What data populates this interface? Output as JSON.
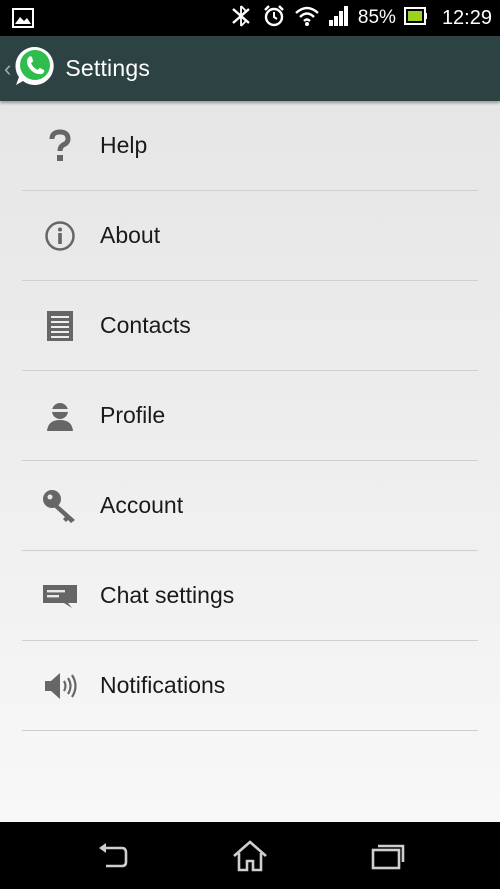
{
  "status_bar": {
    "battery_percent": "85%",
    "time": "12:29",
    "icons": [
      "gallery-icon",
      "bluetooth-icon",
      "alarm-icon",
      "wifi-icon",
      "signal-icon",
      "battery-icon"
    ]
  },
  "action_bar": {
    "title": "Settings",
    "logo": "whatsapp-logo",
    "colors": {
      "background": "#2d4343",
      "logo_green": "#2fbe4d"
    }
  },
  "menu": {
    "items": [
      {
        "label": "Help",
        "icon": "help-icon"
      },
      {
        "label": "About",
        "icon": "info-icon"
      },
      {
        "label": "Contacts",
        "icon": "contacts-list-icon"
      },
      {
        "label": "Profile",
        "icon": "profile-icon"
      },
      {
        "label": "Account",
        "icon": "key-icon"
      },
      {
        "label": "Chat settings",
        "icon": "chat-icon"
      },
      {
        "label": "Notifications",
        "icon": "speaker-icon"
      }
    ]
  },
  "nav_bar": {
    "buttons": [
      "back-icon",
      "home-icon",
      "recent-apps-icon"
    ]
  }
}
